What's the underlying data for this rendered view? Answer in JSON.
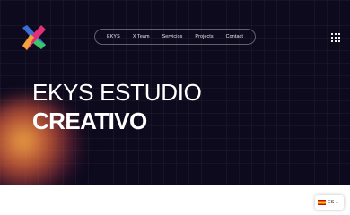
{
  "brand": {
    "logo_icon": "x-logo-icon"
  },
  "nav": {
    "items": [
      {
        "label": "EKYS"
      },
      {
        "label": "X Team"
      },
      {
        "label": "Servicios"
      },
      {
        "label": "Projects"
      },
      {
        "label": "Contact"
      }
    ]
  },
  "menu": {
    "icon": "grid-menu-icon"
  },
  "hero": {
    "title_line1": "EKYS ESTUDIO",
    "title_line2": "CREATIVO"
  },
  "language": {
    "code": "ES",
    "flag_icon": "spain-flag-icon"
  },
  "colors": {
    "background": "#0d0a1e",
    "logo_pink": "#e0307a",
    "logo_orange": "#f4a23a",
    "logo_green": "#39c56a",
    "logo_blue": "#3b6fd8",
    "glow": "#f0a040"
  }
}
